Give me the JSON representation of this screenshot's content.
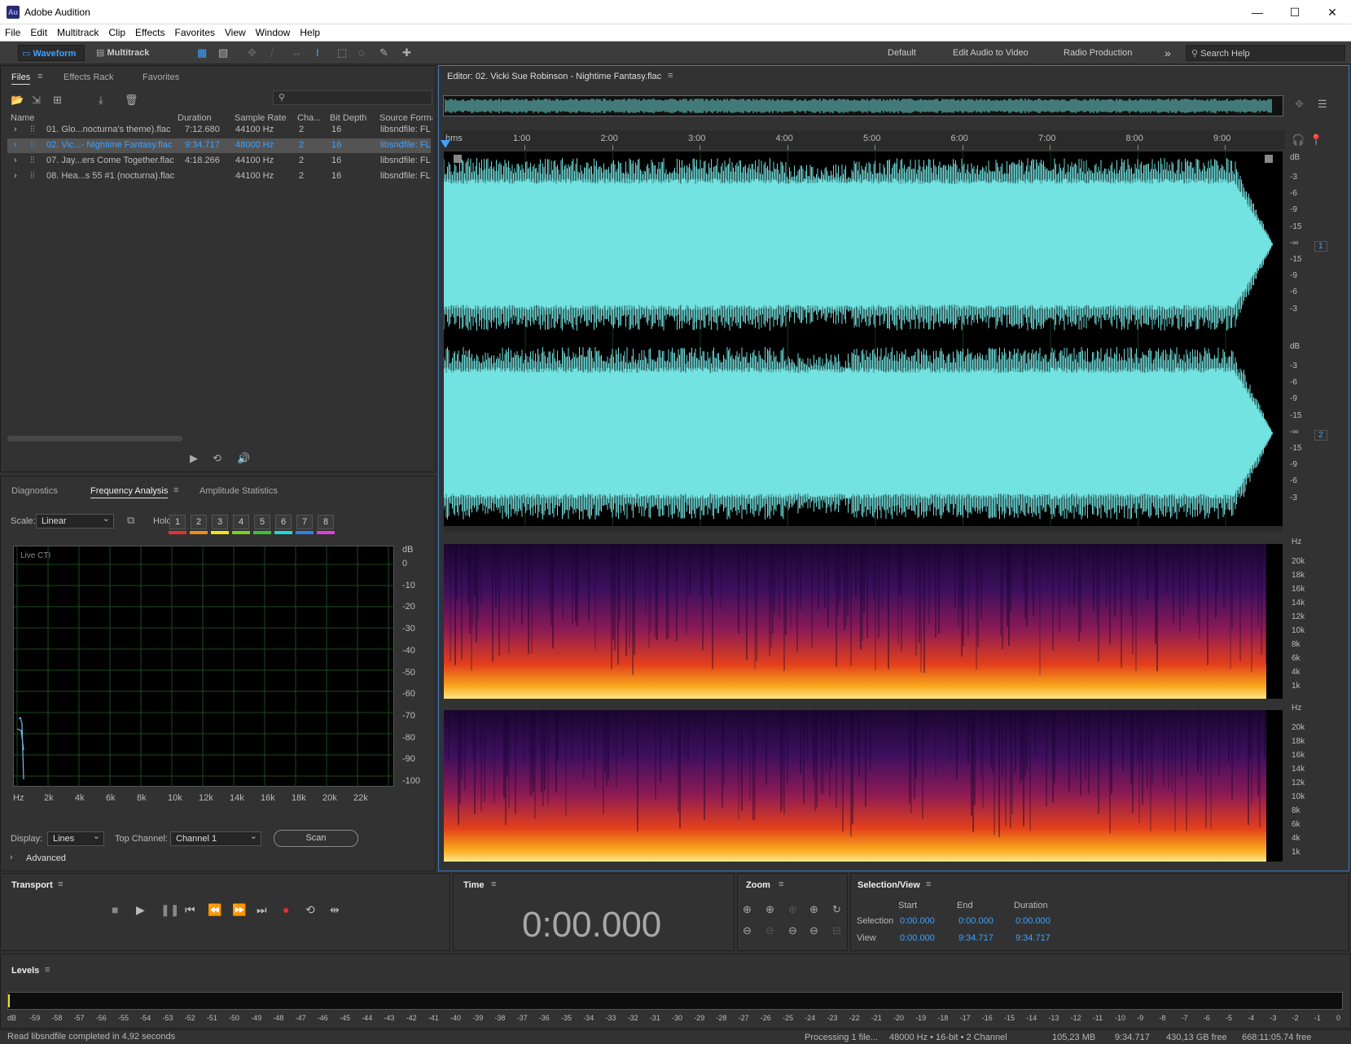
{
  "app": {
    "title": "Adobe Audition",
    "logo": "Au"
  },
  "menu": [
    "File",
    "Edit",
    "Multitrack",
    "Clip",
    "Effects",
    "Favorites",
    "View",
    "Window",
    "Help"
  ],
  "toolbar": {
    "waveform": "Waveform",
    "multitrack": "Multitrack",
    "workspaces": [
      "Default",
      "Edit Audio to Video",
      "Radio Production"
    ],
    "more": "»",
    "search_placeholder": "Search Help"
  },
  "files_panel": {
    "tabs": [
      "Files",
      "Effects Rack",
      "Favorites"
    ],
    "columns": [
      "Name",
      "Duration",
      "Sample Rate",
      "Cha...",
      "Bit Depth",
      "Source Format"
    ],
    "rows": [
      {
        "name": "01. Glo...nocturna's theme).flac",
        "duration": "7:12.680",
        "rate": "44100 Hz",
        "ch": "2",
        "bits": "16",
        "fmt": "libsndfile: FL"
      },
      {
        "name": "02. Vic...- Nightime Fantasy.flac",
        "duration": "9:34.717",
        "rate": "48000 Hz",
        "ch": "2",
        "bits": "16",
        "fmt": "libsndfile: FL"
      },
      {
        "name": "07. Jay...ers Come Together.flac",
        "duration": "4:18.266",
        "rate": "44100 Hz",
        "ch": "2",
        "bits": "16",
        "fmt": "libsndfile: FL"
      },
      {
        "name": "08. Hea...s 55 #1 (nocturna).flac",
        "duration": "",
        "rate": "44100 Hz",
        "ch": "2",
        "bits": "16",
        "fmt": "libsndfile: FL"
      }
    ],
    "selected_index": 1
  },
  "analysis_panel": {
    "tabs": [
      "Diagnostics",
      "Frequency Analysis",
      "Amplitude Statistics"
    ],
    "scale_label": "Scale:",
    "scale_value": "Linear",
    "hold_label": "Hold:",
    "hold_buttons": [
      "1",
      "2",
      "3",
      "4",
      "5",
      "6",
      "7",
      "8"
    ],
    "hold_colors": [
      "#e53030",
      "#f08a1a",
      "#f0e21a",
      "#7ad21e",
      "#3cbf3c",
      "#19d8e0",
      "#2f7fe6",
      "#e23be0"
    ],
    "graph_label": "Live CTI",
    "db_unit": "dB",
    "db_ticks": [
      "0",
      "-10",
      "-20",
      "-30",
      "-40",
      "-50",
      "-60",
      "-70",
      "-80",
      "-90",
      "-100"
    ],
    "hz_ticks": [
      "Hz",
      "2k",
      "4k",
      "6k",
      "8k",
      "10k",
      "12k",
      "14k",
      "16k",
      "18k",
      "20k",
      "22k"
    ],
    "display_label": "Display:",
    "display_value": "Lines",
    "top_channel_label": "Top Channel:",
    "top_channel_value": "Channel 1",
    "scan": "Scan",
    "advanced": "Advanced"
  },
  "editor": {
    "title": "Editor: 02. Vicki Sue Robinson - Nightime Fantasy.flac",
    "ruler_unit": "hms",
    "ruler_marks": [
      "1:00",
      "2:00",
      "3:00",
      "4:00",
      "5:00",
      "6:00",
      "7:00",
      "8:00",
      "9:00"
    ],
    "db_unit": "dB",
    "db_ticks_ch": [
      "-3",
      "-6",
      "-9",
      "-15",
      "-∞",
      "-15",
      "-9",
      "-6",
      "-3"
    ],
    "channels": [
      "1",
      "2"
    ],
    "hz_unit": "Hz",
    "hz_ticks": [
      "20k",
      "18k",
      "16k",
      "14k",
      "12k",
      "10k",
      "8k",
      "6k",
      "4k",
      "1k"
    ],
    "waveform_color": "#72e3e1"
  },
  "transport": {
    "title": "Transport"
  },
  "time_panel": {
    "title": "Time",
    "value": "0:00.000"
  },
  "zoom_panel": {
    "title": "Zoom"
  },
  "selection_panel": {
    "title": "Selection/View",
    "headers": [
      "Start",
      "End",
      "Duration"
    ],
    "selection_label": "Selection",
    "view_label": "View",
    "selection": [
      "0:00.000",
      "0:00.000",
      "0:00.000"
    ],
    "view": [
      "0:00.000",
      "9:34.717",
      "9:34.717"
    ]
  },
  "levels": {
    "title": "Levels",
    "scale": [
      "dB",
      "-59",
      "-58",
      "-57",
      "-56",
      "-55",
      "-54",
      "-53",
      "-52",
      "-51",
      "-50",
      "-49",
      "-48",
      "-47",
      "-46",
      "-45",
      "-44",
      "-43",
      "-42",
      "-41",
      "-40",
      "-39",
      "-38",
      "-37",
      "-36",
      "-35",
      "-34",
      "-33",
      "-32",
      "-31",
      "-30",
      "-29",
      "-28",
      "-27",
      "-26",
      "-25",
      "-24",
      "-23",
      "-22",
      "-21",
      "-20",
      "-19",
      "-18",
      "-17",
      "-16",
      "-15",
      "-14",
      "-13",
      "-12",
      "-11",
      "-10",
      "-9",
      "-8",
      "-7",
      "-6",
      "-5",
      "-4",
      "-3",
      "-2",
      "-1",
      "0"
    ]
  },
  "status": {
    "left": "Read libsndfile completed in 4,92 seconds",
    "processing": "Processing 1 file...",
    "format": "48000 Hz • 16-bit • 2 Channel",
    "size": "105,23 MB",
    "duration": "9:34.717",
    "free": "430,13 GB free",
    "free_time": "668:11:05.74 free"
  }
}
